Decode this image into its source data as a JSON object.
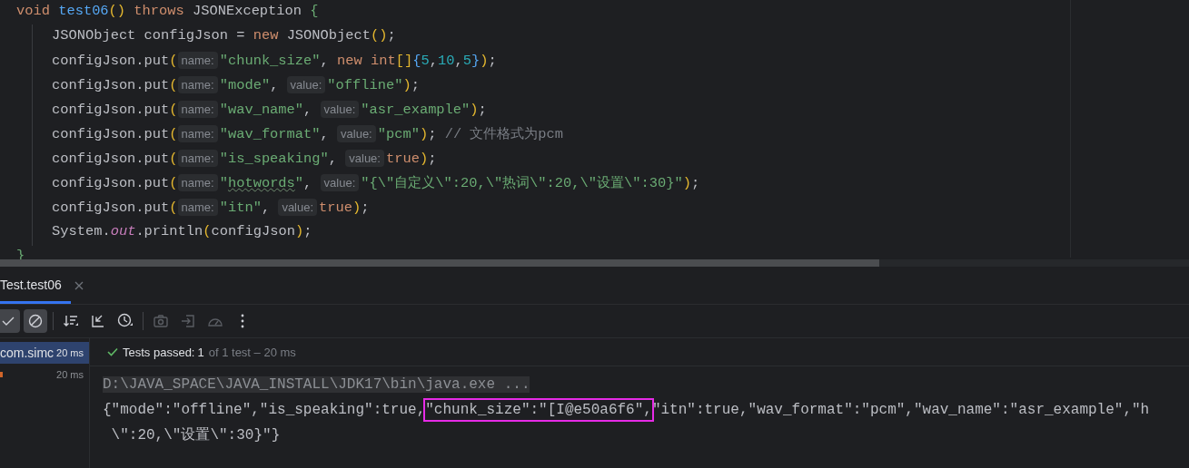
{
  "editor": {
    "lines": [
      {
        "indented": false,
        "tokens": [
          {
            "kind": "kw",
            "text": "void "
          },
          {
            "kind": "fn",
            "text": "test06"
          },
          {
            "kind": "paren",
            "text": "()"
          },
          {
            "kind": "kw",
            "text": " throws"
          },
          {
            "kind": "plain",
            "text": " JSONException "
          },
          {
            "kind": "brace",
            "text": "{"
          }
        ]
      },
      {
        "indented": true,
        "tokens": [
          {
            "kind": "plain",
            "text": "JSONObject configJson = "
          },
          {
            "kind": "kw",
            "text": "new"
          },
          {
            "kind": "plain",
            "text": " JSONObject"
          },
          {
            "kind": "paren",
            "text": "()"
          },
          {
            "kind": "plain",
            "text": ";"
          }
        ]
      },
      {
        "indented": true,
        "tokens": [
          {
            "kind": "plain",
            "text": "configJson.put"
          },
          {
            "kind": "paren",
            "text": "("
          },
          {
            "kind": "hint",
            "text": "name:"
          },
          {
            "kind": "str",
            "text": "\"chunk_size\""
          },
          {
            "kind": "plain",
            "text": ", "
          },
          {
            "kind": "kw",
            "text": "new int"
          },
          {
            "kind": "paren",
            "text": "[]"
          },
          {
            "kind": "brace2",
            "text": "{"
          },
          {
            "kind": "num",
            "text": "5"
          },
          {
            "kind": "plain",
            "text": ","
          },
          {
            "kind": "num",
            "text": "10"
          },
          {
            "kind": "plain",
            "text": ","
          },
          {
            "kind": "num",
            "text": "5"
          },
          {
            "kind": "brace2",
            "text": "}"
          },
          {
            "kind": "paren",
            "text": ")"
          },
          {
            "kind": "plain",
            "text": ";"
          }
        ]
      },
      {
        "indented": true,
        "tokens": [
          {
            "kind": "plain",
            "text": "configJson.put"
          },
          {
            "kind": "paren",
            "text": "("
          },
          {
            "kind": "hint",
            "text": "name:"
          },
          {
            "kind": "str",
            "text": "\"mode\""
          },
          {
            "kind": "plain",
            "text": ", "
          },
          {
            "kind": "hint",
            "text": "value:"
          },
          {
            "kind": "str",
            "text": "\"offline\""
          },
          {
            "kind": "paren",
            "text": ")"
          },
          {
            "kind": "plain",
            "text": ";"
          }
        ]
      },
      {
        "indented": true,
        "tokens": [
          {
            "kind": "plain",
            "text": "configJson.put"
          },
          {
            "kind": "paren",
            "text": "("
          },
          {
            "kind": "hint",
            "text": "name:"
          },
          {
            "kind": "str",
            "text": "\"wav_name\""
          },
          {
            "kind": "plain",
            "text": ", "
          },
          {
            "kind": "hint",
            "text": "value:"
          },
          {
            "kind": "str",
            "text": "\"asr_example\""
          },
          {
            "kind": "paren",
            "text": ")"
          },
          {
            "kind": "plain",
            "text": ";"
          }
        ]
      },
      {
        "indented": true,
        "tokens": [
          {
            "kind": "plain",
            "text": "configJson.put"
          },
          {
            "kind": "paren",
            "text": "("
          },
          {
            "kind": "hint",
            "text": "name:"
          },
          {
            "kind": "str",
            "text": "\"wav_format\""
          },
          {
            "kind": "plain",
            "text": ", "
          },
          {
            "kind": "hint",
            "text": "value:"
          },
          {
            "kind": "str",
            "text": "\"pcm\""
          },
          {
            "kind": "paren",
            "text": ")"
          },
          {
            "kind": "plain",
            "text": "; "
          },
          {
            "kind": "comment",
            "text": "// 文件格式为pcm"
          }
        ]
      },
      {
        "indented": true,
        "tokens": [
          {
            "kind": "plain",
            "text": "configJson.put"
          },
          {
            "kind": "paren",
            "text": "("
          },
          {
            "kind": "hint",
            "text": "name:"
          },
          {
            "kind": "str",
            "text": "\"is_speaking\""
          },
          {
            "kind": "plain",
            "text": ", "
          },
          {
            "kind": "hint",
            "text": "value:"
          },
          {
            "kind": "kw",
            "text": "true"
          },
          {
            "kind": "paren",
            "text": ")"
          },
          {
            "kind": "plain",
            "text": ";"
          }
        ]
      },
      {
        "indented": true,
        "tokens": [
          {
            "kind": "plain",
            "text": "configJson.put"
          },
          {
            "kind": "paren",
            "text": "("
          },
          {
            "kind": "hint",
            "text": "name:"
          },
          {
            "kind": "str",
            "text": "\""
          },
          {
            "kind": "typo",
            "text": "hotwords"
          },
          {
            "kind": "str",
            "text": "\""
          },
          {
            "kind": "plain",
            "text": ", "
          },
          {
            "kind": "hint",
            "text": "value:"
          },
          {
            "kind": "str",
            "text": "\"{\\\"自定义\\\":20,\\\"热词\\\":20,\\\"设置\\\":30}\""
          },
          {
            "kind": "paren",
            "text": ")"
          },
          {
            "kind": "plain",
            "text": ";"
          }
        ]
      },
      {
        "indented": true,
        "tokens": [
          {
            "kind": "plain",
            "text": "configJson.put"
          },
          {
            "kind": "paren",
            "text": "("
          },
          {
            "kind": "hint",
            "text": "name:"
          },
          {
            "kind": "str",
            "text": "\"itn\""
          },
          {
            "kind": "plain",
            "text": ", "
          },
          {
            "kind": "hint",
            "text": "value:"
          },
          {
            "kind": "kw",
            "text": "true"
          },
          {
            "kind": "paren",
            "text": ")"
          },
          {
            "kind": "plain",
            "text": ";"
          }
        ]
      },
      {
        "indented": true,
        "tokens": [
          {
            "kind": "plain",
            "text": "System."
          },
          {
            "kind": "field",
            "text": "out"
          },
          {
            "kind": "plain",
            "text": ".println"
          },
          {
            "kind": "paren",
            "text": "("
          },
          {
            "kind": "plain",
            "text": "configJson"
          },
          {
            "kind": "paren",
            "text": ")"
          },
          {
            "kind": "plain",
            "text": ";"
          }
        ]
      },
      {
        "indented": false,
        "tokens": [
          {
            "kind": "brace",
            "text": "}"
          }
        ]
      }
    ]
  },
  "run_panel": {
    "tabs": [
      {
        "label": "Test.test06",
        "selected": true
      }
    ],
    "toolbar": [
      {
        "kind": "check",
        "selected": true,
        "disabled": false
      },
      {
        "kind": "stop",
        "selected": true,
        "disabled": false
      },
      {
        "kind": "sort",
        "selected": false,
        "disabled": false
      },
      {
        "kind": "collapse",
        "selected": false,
        "disabled": false
      },
      {
        "kind": "history",
        "selected": false,
        "disabled": false
      },
      {
        "kind": "camera",
        "selected": false,
        "disabled": true
      },
      {
        "kind": "import",
        "selected": false,
        "disabled": true
      },
      {
        "kind": "gauge",
        "selected": false,
        "disabled": true
      },
      {
        "kind": "more",
        "selected": false,
        "disabled": false
      }
    ],
    "tree": [
      {
        "label": "com.simc",
        "time": "20 ms",
        "selected": true
      },
      {
        "time": "20 ms",
        "selected": false
      }
    ],
    "status": {
      "label": "Tests passed:",
      "count": "1",
      "detail": "of 1 test – 20 ms"
    },
    "console": {
      "command": "D:\\JAVA_SPACE\\JAVA_INSTALL\\JDK17\\bin\\java.exe ...",
      "output_before": "{\"mode\":\"offline\",\"is_speaking\":true,",
      "output_highlighted": "\"chunk_size\":\"[I@e50a6f6\",",
      "output_after": "\"itn\":true,\"wav_format\":\"pcm\",\"wav_name\":\"asr_example\",\"h",
      "output_line_2": " \\\":20,\\\"设置\\\":30}\"}"
    }
  }
}
